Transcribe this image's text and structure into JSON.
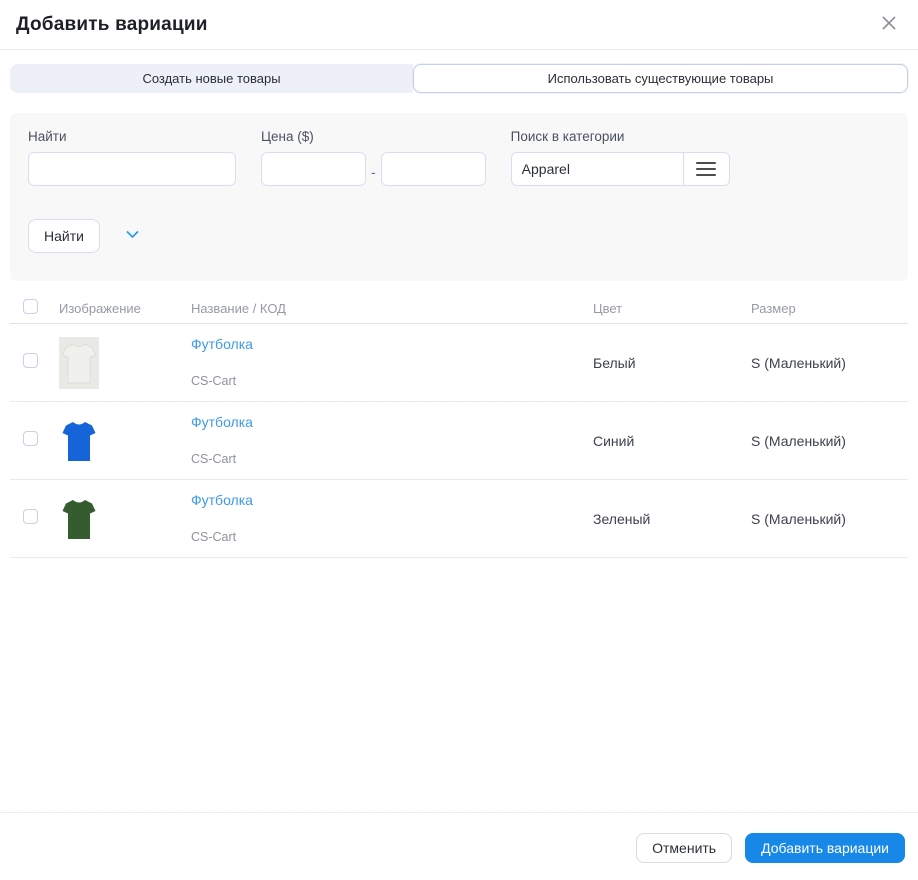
{
  "modal": {
    "title": "Добавить вариации"
  },
  "tabs": [
    {
      "label": "Создать новые товары",
      "active": false
    },
    {
      "label": "Использовать существующие товары",
      "active": true
    }
  ],
  "search_form": {
    "find_label": "Найти",
    "find_value": "",
    "price_label": "Цена ($)",
    "price_from": "",
    "price_to": "",
    "price_separator": "-",
    "category_label": "Поиск в категории",
    "category_value": "Apparel",
    "search_button": "Найти"
  },
  "table": {
    "headers": {
      "image": "Изображение",
      "name": "Название / КОД",
      "color": "Цвет",
      "size": "Размер"
    },
    "rows": [
      {
        "name": "Футболка",
        "code": "CS-Cart",
        "color": "Белый",
        "size": "S (Маленький)",
        "shirt_color": "#f0f0ec",
        "image_bg": "#e9e9e6"
      },
      {
        "name": "Футболка",
        "code": "CS-Cart",
        "color": "Синий",
        "size": "S (Маленький)",
        "shirt_color": "#1565d8",
        "image_bg": "#ffffff"
      },
      {
        "name": "Футболка",
        "code": "CS-Cart",
        "color": "Зеленый",
        "size": "S (Маленький)",
        "shirt_color": "#345c2f",
        "image_bg": "#ffffff"
      }
    ]
  },
  "footer": {
    "cancel_button": "Отменить",
    "submit_button": "Добавить вариации"
  },
  "colors": {
    "accent_blue": "#1787e8",
    "link_blue": "#3d9be5",
    "chevron_blue": "#2e9ce8"
  }
}
